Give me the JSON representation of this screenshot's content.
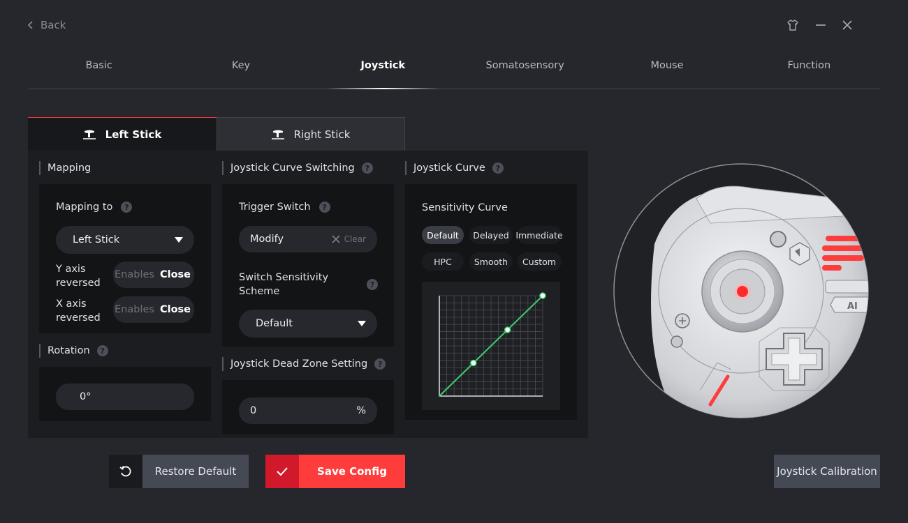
{
  "header": {
    "back_label": "Back"
  },
  "tabs": [
    {
      "label": "Basic",
      "active": false
    },
    {
      "label": "Key",
      "active": false
    },
    {
      "label": "Joystick",
      "active": true
    },
    {
      "label": "Somatosensory",
      "active": false
    },
    {
      "label": "Mouse",
      "active": false
    },
    {
      "label": "Function",
      "active": false
    }
  ],
  "sticks": {
    "left_label": "Left Stick",
    "right_label": "Right Stick",
    "selected": "Left Stick"
  },
  "mapping": {
    "title": "Mapping",
    "mapping_to_label": "Mapping to",
    "mapping_to_value": "Left Stick",
    "y_axis_label_1": "Y axis",
    "y_axis_label_2": "reversed",
    "x_axis_label_1": "X axis",
    "x_axis_label_2": "reversed",
    "toggle_off": "Enables",
    "toggle_on": "Close"
  },
  "rotation": {
    "title": "Rotation",
    "value": "0°"
  },
  "curve_switching": {
    "title": "Joystick Curve Switching",
    "trigger_label": "Trigger Switch",
    "trigger_value": "Modify",
    "clear_label": "Clear",
    "scheme_label_1": "Switch Sensitivity",
    "scheme_label_2": "Scheme",
    "scheme_value": "Default"
  },
  "dead_zone": {
    "title": "Joystick Dead Zone Setting",
    "value": "0",
    "unit": "%"
  },
  "joystick_curve": {
    "title": "Joystick Curve",
    "sensitivity_label": "Sensitivity Curve",
    "presets": [
      "Default",
      "Delayed",
      "Immediate",
      "HPC",
      "Smooth",
      "Custom"
    ],
    "selected": "Default",
    "line_color": "#3ecf6e",
    "points": [
      [
        0,
        0
      ],
      [
        0.33,
        0.33
      ],
      [
        0.66,
        0.66
      ],
      [
        1,
        1
      ]
    ]
  },
  "footer": {
    "restore_label": "Restore Default",
    "save_label": "Save Config",
    "calibration_label": "Joystick Calibration"
  },
  "colors": {
    "accent": "#ff3c3c",
    "accent_dark": "#d0192b",
    "background": "#25272c",
    "panel": "#1c1d21"
  }
}
